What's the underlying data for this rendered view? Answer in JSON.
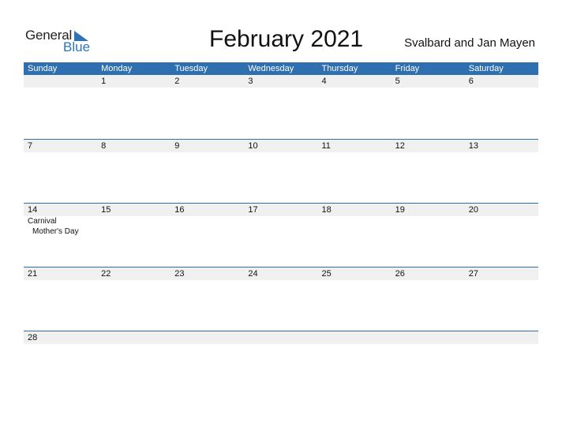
{
  "logo": {
    "general": "General",
    "blue": "Blue"
  },
  "header": {
    "title": "February 2021",
    "region": "Svalbard and Jan Mayen"
  },
  "colors": {
    "accent": "#2e6faf",
    "row_bg": "#f0f0f0"
  },
  "days": [
    "Sunday",
    "Monday",
    "Tuesday",
    "Wednesday",
    "Thursday",
    "Friday",
    "Saturday"
  ],
  "weeks": [
    {
      "dates": [
        "",
        "1",
        "2",
        "3",
        "4",
        "5",
        "6"
      ],
      "events": [
        [],
        [],
        [],
        [],
        [],
        [],
        []
      ]
    },
    {
      "dates": [
        "7",
        "8",
        "9",
        "10",
        "11",
        "12",
        "13"
      ],
      "events": [
        [],
        [],
        [],
        [],
        [],
        [],
        []
      ]
    },
    {
      "dates": [
        "14",
        "15",
        "16",
        "17",
        "18",
        "19",
        "20"
      ],
      "events": [
        [
          "Carnival",
          "Mother's Day"
        ],
        [],
        [],
        [],
        [],
        [],
        []
      ]
    },
    {
      "dates": [
        "21",
        "22",
        "23",
        "24",
        "25",
        "26",
        "27"
      ],
      "events": [
        [],
        [],
        [],
        [],
        [],
        [],
        []
      ]
    },
    {
      "dates": [
        "28",
        "",
        "",
        "",
        "",
        "",
        ""
      ],
      "events": [
        [],
        [],
        [],
        [],
        [],
        [],
        []
      ]
    }
  ]
}
